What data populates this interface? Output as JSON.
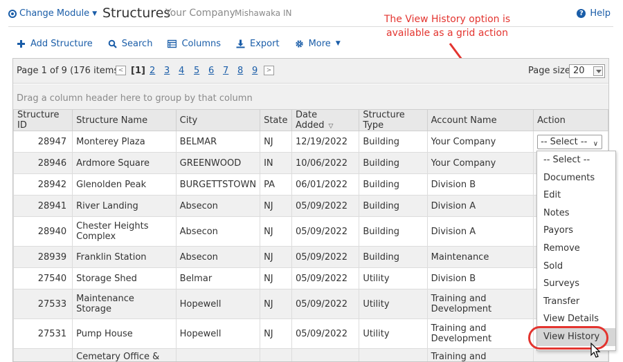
{
  "header": {
    "change_module": "Change Module",
    "title": "Structures",
    "company": "Your Company",
    "location": "Mishawaka IN",
    "help": "Help"
  },
  "annotation": {
    "line1": "The View History option is",
    "line2": "available as a grid action",
    "color": "#e3342f"
  },
  "toolbar": {
    "add": "Add Structure",
    "search": "Search",
    "columns": "Columns",
    "export": "Export",
    "more": "More"
  },
  "pager": {
    "summary": "Page 1 of 9 (176 items)",
    "current": "[1]",
    "pages": [
      "2",
      "3",
      "4",
      "5",
      "6",
      "7",
      "8",
      "9"
    ],
    "page_size_label": "Page size:",
    "page_size": "20"
  },
  "group_hint": "Drag a column header here to group by that column",
  "columns": [
    "Structure ID",
    "Structure Name",
    "City",
    "State",
    "Date Added",
    "Structure Type",
    "Account Name",
    "Action"
  ],
  "rows": [
    {
      "id": "28947",
      "name": "Monterey Plaza",
      "city": "BELMAR",
      "state": "NJ",
      "date": "12/19/2022",
      "type": "Building",
      "account": "Your Company"
    },
    {
      "id": "28946",
      "name": "Ardmore Square",
      "city": "GREENWOOD",
      "state": "IN",
      "date": "10/06/2022",
      "type": "Building",
      "account": "Your Company"
    },
    {
      "id": "28942",
      "name": "Glenolden Peak",
      "city": "BURGETTSTOWN",
      "state": "PA",
      "date": "06/01/2022",
      "type": "Building",
      "account": "Division B"
    },
    {
      "id": "28941",
      "name": "River Landing",
      "city": "Absecon",
      "state": "NJ",
      "date": "05/09/2022",
      "type": "Building",
      "account": "Division A"
    },
    {
      "id": "28940",
      "name": "Chester Heights Complex",
      "city": "Absecon",
      "state": "NJ",
      "date": "05/09/2022",
      "type": "Building",
      "account": "Division A"
    },
    {
      "id": "28939",
      "name": "Franklin Station",
      "city": "Absecon",
      "state": "NJ",
      "date": "05/09/2022",
      "type": "Building",
      "account": "Maintenance"
    },
    {
      "id": "27540",
      "name": "Storage Shed",
      "city": "Belmar",
      "state": "NJ",
      "date": "05/09/2022",
      "type": "Utility",
      "account": "Division B"
    },
    {
      "id": "27533",
      "name": "Maintenance Storage",
      "city": "Hopewell",
      "state": "NJ",
      "date": "05/09/2022",
      "type": "Utility",
      "account": "Training and Development"
    },
    {
      "id": "27531",
      "name": "Pump House",
      "city": "Hopewell",
      "state": "NJ",
      "date": "05/09/2022",
      "type": "Utility",
      "account": "Training and Development"
    },
    {
      "id": "",
      "name": "Cemetary Office &",
      "city": "",
      "state": "",
      "date": "",
      "type": "",
      "account": "Training and"
    }
  ],
  "action_select": "-- Select --",
  "action_options": [
    "-- Select --",
    "Documents",
    "Edit",
    "Notes",
    "Payors",
    "Remove",
    "Sold",
    "Surveys",
    "Transfer",
    "View Details",
    "View History"
  ]
}
